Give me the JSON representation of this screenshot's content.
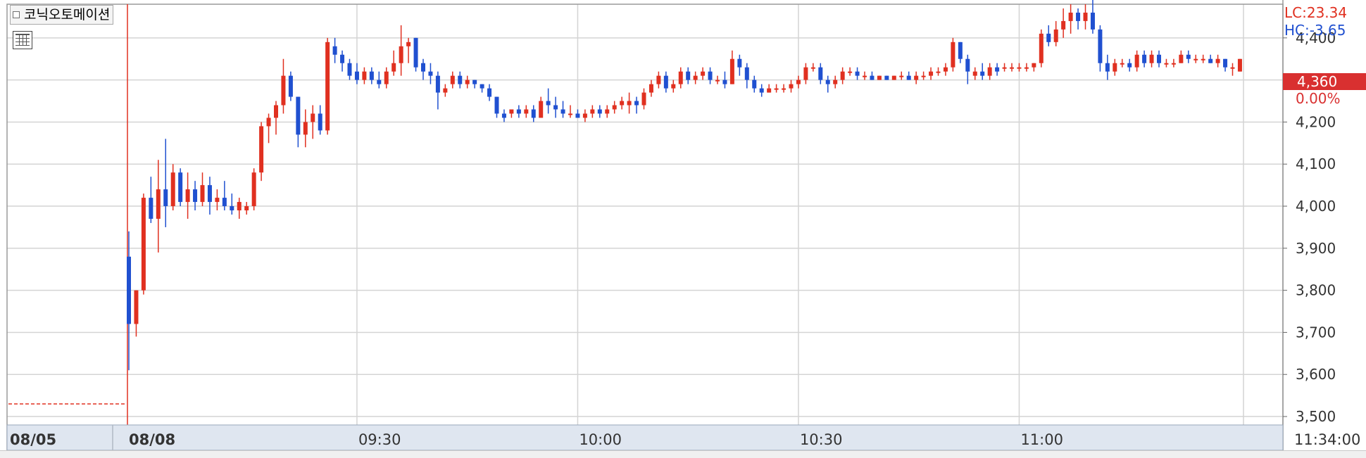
{
  "stock": {
    "name": "코닉오토메이션"
  },
  "toolbar": {
    "icon": "table-grid-icon"
  },
  "indicators": {
    "lc": "LC:23.34",
    "hc": "HC:-3.65"
  },
  "current": {
    "price_label": "4,360",
    "change_label": "0.00%",
    "price": 4360
  },
  "colors": {
    "up": "#e03020",
    "down": "#2050d0",
    "grid": "#d4d4d4",
    "axis_bg": "#dfe6f0",
    "price_tag": "#d93030"
  },
  "chart_data": {
    "type": "candlestick",
    "title": "",
    "xlabel": "",
    "ylabel": "",
    "ylim": [
      3480,
      4480
    ],
    "yticks": [
      3500,
      3600,
      3700,
      3800,
      3900,
      4000,
      4100,
      4200,
      4300,
      4400
    ],
    "ytick_labels": [
      "3,500",
      "3,600",
      "3,700",
      "3,800",
      "3,900",
      "4,000",
      "4,100",
      "4,200",
      "4,300",
      "4,400"
    ],
    "xaxis_labels": [
      {
        "label": "08/05",
        "bar": -5
      },
      {
        "label": "08/08",
        "bar": 0
      },
      {
        "label": "09:30",
        "bar": 31
      },
      {
        "label": "10:00",
        "bar": 61
      },
      {
        "label": "10:30",
        "bar": 91
      },
      {
        "label": "11:00",
        "bar": 121
      },
      {
        "label": "11:34:00",
        "bar": 155
      }
    ],
    "prev_close": 3530,
    "gap_label": "08/05",
    "grid": true,
    "candles": [
      [
        3880,
        3940,
        3610,
        3720
      ],
      [
        3720,
        3800,
        3690,
        3800
      ],
      [
        3800,
        4030,
        3790,
        4020
      ],
      [
        4020,
        4070,
        3960,
        3970
      ],
      [
        3970,
        4110,
        3890,
        4040
      ],
      [
        4040,
        4160,
        3950,
        4000
      ],
      [
        4000,
        4100,
        3990,
        4080
      ],
      [
        4080,
        4090,
        4000,
        4010
      ],
      [
        4010,
        4080,
        3970,
        4040
      ],
      [
        4040,
        4060,
        3990,
        4010
      ],
      [
        4010,
        4080,
        4000,
        4050
      ],
      [
        4050,
        4070,
        3980,
        4010
      ],
      [
        4010,
        4040,
        3990,
        4020
      ],
      [
        4020,
        4060,
        3990,
        4000
      ],
      [
        4000,
        4030,
        3980,
        3990
      ],
      [
        3990,
        4020,
        3970,
        4010
      ],
      [
        3990,
        4010,
        3980,
        4000
      ],
      [
        4000,
        4090,
        3990,
        4080
      ],
      [
        4080,
        4200,
        4060,
        4190
      ],
      [
        4190,
        4220,
        4150,
        4210
      ],
      [
        4210,
        4250,
        4170,
        4240
      ],
      [
        4240,
        4350,
        4220,
        4310
      ],
      [
        4310,
        4320,
        4250,
        4260
      ],
      [
        4260,
        4260,
        4140,
        4170
      ],
      [
        4170,
        4230,
        4140,
        4200
      ],
      [
        4200,
        4240,
        4160,
        4220
      ],
      [
        4220,
        4240,
        4170,
        4180
      ],
      [
        4180,
        4400,
        4170,
        4390
      ],
      [
        4380,
        4400,
        4340,
        4360
      ],
      [
        4360,
        4370,
        4320,
        4340
      ],
      [
        4340,
        4350,
        4300,
        4310
      ],
      [
        4320,
        4340,
        4290,
        4300
      ],
      [
        4300,
        4330,
        4290,
        4320
      ],
      [
        4320,
        4330,
        4290,
        4300
      ],
      [
        4300,
        4320,
        4280,
        4290
      ],
      [
        4290,
        4330,
        4280,
        4320
      ],
      [
        4320,
        4370,
        4310,
        4340
      ],
      [
        4340,
        4430,
        4310,
        4380
      ],
      [
        4380,
        4400,
        4340,
        4390
      ],
      [
        4400,
        4400,
        4320,
        4330
      ],
      [
        4340,
        4350,
        4300,
        4320
      ],
      [
        4320,
        4340,
        4290,
        4310
      ],
      [
        4310,
        4320,
        4230,
        4270
      ],
      [
        4270,
        4290,
        4260,
        4280
      ],
      [
        4290,
        4320,
        4280,
        4310
      ],
      [
        4310,
        4320,
        4280,
        4290
      ],
      [
        4290,
        4310,
        4280,
        4300
      ],
      [
        4300,
        4300,
        4280,
        4290
      ],
      [
        4290,
        4290,
        4270,
        4280
      ],
      [
        4280,
        4290,
        4250,
        4260
      ],
      [
        4260,
        4260,
        4210,
        4220
      ],
      [
        4220,
        4230,
        4200,
        4210
      ],
      [
        4220,
        4230,
        4210,
        4230
      ],
      [
        4230,
        4240,
        4210,
        4220
      ],
      [
        4220,
        4240,
        4210,
        4230
      ],
      [
        4230,
        4240,
        4200,
        4210
      ],
      [
        4210,
        4260,
        4210,
        4250
      ],
      [
        4250,
        4280,
        4220,
        4240
      ],
      [
        4240,
        4260,
        4210,
        4230
      ],
      [
        4230,
        4250,
        4210,
        4220
      ],
      [
        4220,
        4240,
        4210,
        4220
      ],
      [
        4220,
        4230,
        4210,
        4210
      ],
      [
        4210,
        4230,
        4200,
        4220
      ],
      [
        4220,
        4240,
        4210,
        4230
      ],
      [
        4230,
        4240,
        4210,
        4220
      ],
      [
        4220,
        4240,
        4210,
        4230
      ],
      [
        4230,
        4250,
        4220,
        4240
      ],
      [
        4240,
        4260,
        4230,
        4250
      ],
      [
        4240,
        4270,
        4220,
        4250
      ],
      [
        4250,
        4260,
        4220,
        4240
      ],
      [
        4240,
        4280,
        4230,
        4270
      ],
      [
        4270,
        4300,
        4260,
        4290
      ],
      [
        4290,
        4320,
        4280,
        4310
      ],
      [
        4310,
        4320,
        4270,
        4280
      ],
      [
        4280,
        4300,
        4270,
        4290
      ],
      [
        4290,
        4330,
        4280,
        4320
      ],
      [
        4320,
        4330,
        4290,
        4300
      ],
      [
        4300,
        4320,
        4290,
        4310
      ],
      [
        4310,
        4330,
        4300,
        4320
      ],
      [
        4320,
        4330,
        4290,
        4300
      ],
      [
        4300,
        4310,
        4290,
        4300
      ],
      [
        4300,
        4320,
        4280,
        4290
      ],
      [
        4290,
        4370,
        4290,
        4350
      ],
      [
        4350,
        4360,
        4310,
        4330
      ],
      [
        4330,
        4340,
        4280,
        4300
      ],
      [
        4300,
        4310,
        4270,
        4280
      ],
      [
        4280,
        4290,
        4260,
        4270
      ],
      [
        4270,
        4290,
        4270,
        4280
      ],
      [
        4280,
        4290,
        4270,
        4280
      ],
      [
        4280,
        4290,
        4270,
        4280
      ],
      [
        4280,
        4300,
        4270,
        4290
      ],
      [
        4290,
        4310,
        4280,
        4300
      ],
      [
        4300,
        4340,
        4290,
        4330
      ],
      [
        4330,
        4340,
        4320,
        4330
      ],
      [
        4330,
        4340,
        4290,
        4300
      ],
      [
        4300,
        4310,
        4270,
        4290
      ],
      [
        4290,
        4310,
        4280,
        4300
      ],
      [
        4300,
        4330,
        4290,
        4320
      ],
      [
        4320,
        4330,
        4310,
        4320
      ],
      [
        4320,
        4330,
        4300,
        4310
      ],
      [
        4310,
        4320,
        4300,
        4310
      ],
      [
        4310,
        4320,
        4300,
        4300
      ],
      [
        4300,
        4310,
        4300,
        4310
      ],
      [
        4310,
        4310,
        4300,
        4300
      ],
      [
        4300,
        4310,
        4300,
        4310
      ],
      [
        4310,
        4320,
        4300,
        4310
      ],
      [
        4310,
        4320,
        4300,
        4300
      ],
      [
        4300,
        4320,
        4290,
        4310
      ],
      [
        4310,
        4320,
        4300,
        4310
      ],
      [
        4310,
        4330,
        4300,
        4320
      ],
      [
        4320,
        4330,
        4310,
        4320
      ],
      [
        4320,
        4340,
        4310,
        4330
      ],
      [
        4330,
        4400,
        4320,
        4390
      ],
      [
        4390,
        4390,
        4340,
        4350
      ],
      [
        4350,
        4360,
        4290,
        4320
      ],
      [
        4310,
        4330,
        4300,
        4320
      ],
      [
        4320,
        4340,
        4300,
        4310
      ],
      [
        4310,
        4340,
        4300,
        4330
      ],
      [
        4330,
        4340,
        4310,
        4320
      ],
      [
        4330,
        4340,
        4320,
        4330
      ],
      [
        4330,
        4340,
        4320,
        4330
      ],
      [
        4330,
        4340,
        4320,
        4330
      ],
      [
        4330,
        4340,
        4320,
        4330
      ],
      [
        4330,
        4340,
        4320,
        4340
      ],
      [
        4340,
        4420,
        4330,
        4410
      ],
      [
        4410,
        4430,
        4380,
        4390
      ],
      [
        4390,
        4440,
        4380,
        4420
      ],
      [
        4420,
        4470,
        4400,
        4440
      ],
      [
        4440,
        4480,
        4410,
        4460
      ],
      [
        4460,
        4470,
        4420,
        4440
      ],
      [
        4440,
        4480,
        4420,
        4460
      ],
      [
        4460,
        4500,
        4410,
        4420
      ],
      [
        4420,
        4430,
        4320,
        4340
      ],
      [
        4340,
        4360,
        4300,
        4320
      ],
      [
        4320,
        4350,
        4310,
        4340
      ],
      [
        4340,
        4350,
        4330,
        4340
      ],
      [
        4340,
        4350,
        4320,
        4330
      ],
      [
        4330,
        4370,
        4320,
        4360
      ],
      [
        4360,
        4370,
        4330,
        4340
      ],
      [
        4340,
        4370,
        4330,
        4360
      ],
      [
        4360,
        4370,
        4330,
        4340
      ],
      [
        4340,
        4350,
        4330,
        4340
      ],
      [
        4340,
        4350,
        4330,
        4340
      ],
      [
        4340,
        4370,
        4340,
        4360
      ],
      [
        4360,
        4370,
        4340,
        4350
      ],
      [
        4350,
        4360,
        4340,
        4350
      ],
      [
        4350,
        4360,
        4340,
        4350
      ],
      [
        4350,
        4360,
        4340,
        4340
      ],
      [
        4340,
        4360,
        4330,
        4350
      ],
      [
        4350,
        4350,
        4320,
        4330
      ],
      [
        4330,
        4340,
        4310,
        4330
      ],
      [
        4320,
        4350,
        4320,
        4350
      ]
    ]
  }
}
